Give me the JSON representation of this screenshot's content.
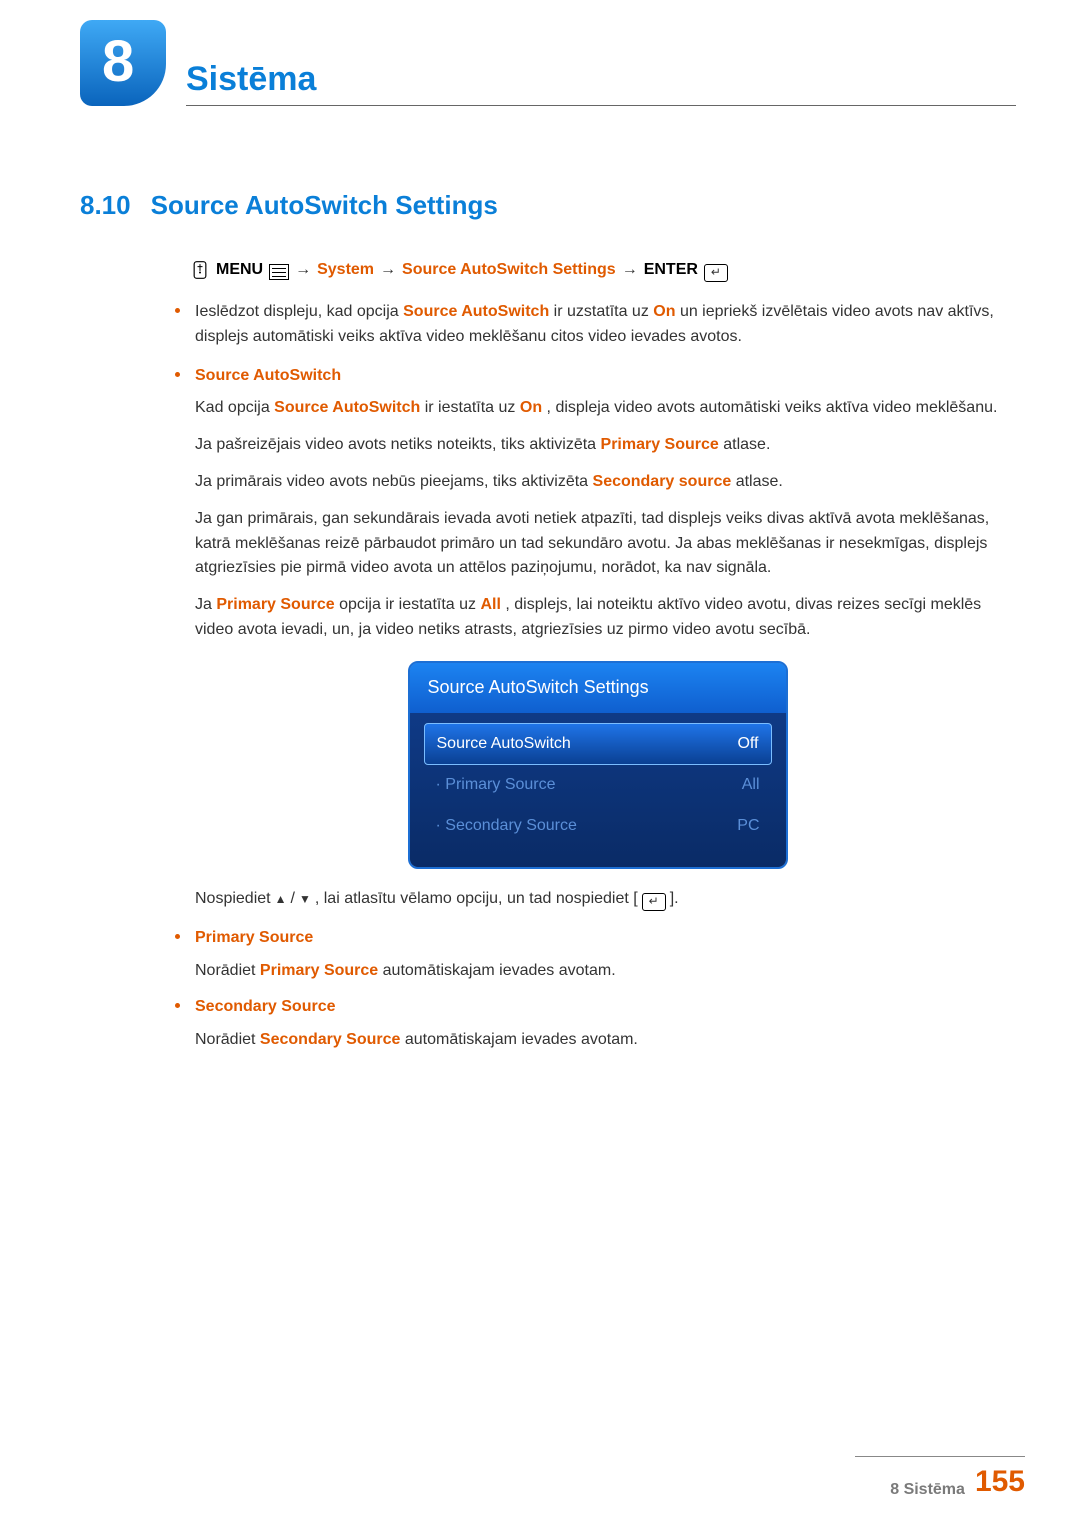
{
  "chapter": {
    "number": "8",
    "title": "Sistēma"
  },
  "section": {
    "number": "8.10",
    "title": "Source AutoSwitch Settings"
  },
  "breadcrumb": {
    "menu_label": "MENU",
    "arrow": " → ",
    "system": "System",
    "item": "Source AutoSwitch Settings",
    "enter": "ENTER"
  },
  "intro_bullet": {
    "pre": "Ieslēdzot displeju, kad opcija ",
    "em1": "Source AutoSwitch",
    "mid1": " ir uzstatīta uz ",
    "em2": "On",
    "post": " un iepriekš izvēlētais video avots nav aktīvs, displejs automātiski veiks aktīva video meklēšanu citos video ievades avotos."
  },
  "auto_switch": {
    "head": "Source AutoSwitch",
    "p1_pre": "Kad opcija ",
    "p1_em1": "Source AutoSwitch",
    "p1_mid": " ir iestatīta uz ",
    "p1_em2": "On",
    "p1_post": ", displeja video avots automātiski veiks aktīva video meklēšanu.",
    "p2_pre": "Ja pašreizējais video avots netiks noteikts, tiks aktivizēta ",
    "p2_em": "Primary Source",
    "p2_post": " atlase.",
    "p3_pre": "Ja primārais video avots nebūs pieejams, tiks aktivizēta ",
    "p3_em": "Secondary source",
    "p3_post": " atlase.",
    "p4": "Ja gan primārais, gan sekundārais ievada avoti netiek atpazīti, tad displejs veiks divas aktīvā avota meklēšanas, katrā meklēšanas reizē pārbaudot primāro un tad sekundāro avotu. Ja abas meklēšanas ir nesekmīgas, displejs atgriezīsies pie pirmā video avota un attēlos paziņojumu, norādot, ka nav signāla.",
    "p5_pre": "Ja ",
    "p5_em1": "Primary Source",
    "p5_mid": " opcija ir iestatīta uz ",
    "p5_em2": "All",
    "p5_post": ", displejs, lai noteiktu aktīvo video avotu, divas reizes secīgi meklēs video avota ievadi, un, ja video netiks atrasts, atgriezīsies uz pirmo video avotu secībā."
  },
  "osd": {
    "title": "Source AutoSwitch Settings",
    "rows": [
      {
        "label": "Source AutoSwitch",
        "value": "Off",
        "style": "selected"
      },
      {
        "label": "· Primary Source",
        "value": "All",
        "style": "dim"
      },
      {
        "label": "· Secondary Source",
        "value": "PC",
        "style": "dim"
      }
    ]
  },
  "instruction": {
    "pre": "Nospiediet ",
    "up": "▲",
    "slash": "/",
    "down": "▼",
    "mid": ", lai atlasītu vēlamo opciju, un tad nospiediet [",
    "post": "]."
  },
  "primary": {
    "head": "Primary Source",
    "text_pre": "Norādiet ",
    "text_em": "Primary Source",
    "text_post": " automātiskajam ievades avotam."
  },
  "secondary": {
    "head": "Secondary Source",
    "text_pre": "Norādiet ",
    "text_em": "Secondary Source",
    "text_post": " automātiskajam ievades avotam."
  },
  "footer": {
    "label": "8 Sistēma",
    "page": "155"
  }
}
